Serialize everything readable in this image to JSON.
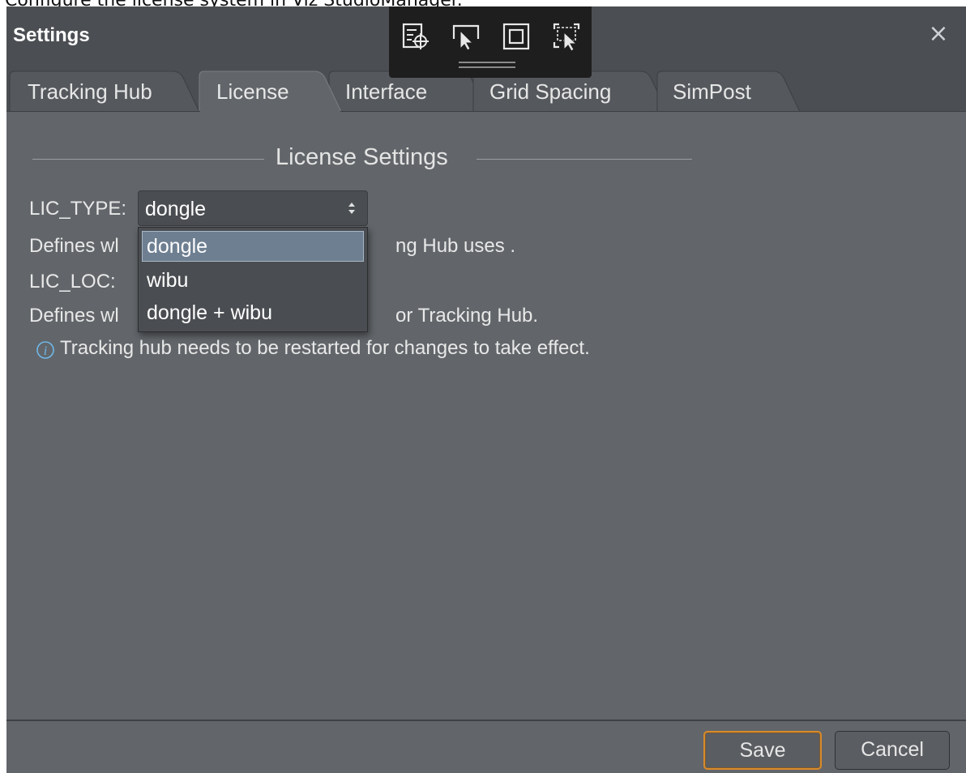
{
  "caption": "Configure the license system in Viz StudioManager.",
  "window": {
    "title": "Settings",
    "close_glyph": "×"
  },
  "capture_toolbar": {
    "icons": [
      "settings-target-icon",
      "select-pointer-icon",
      "window-capture-icon",
      "region-select-icon"
    ]
  },
  "tabs": [
    {
      "label": "Tracking Hub",
      "active": false
    },
    {
      "label": "License",
      "active": true
    },
    {
      "label": "Interface",
      "active": false
    },
    {
      "label": "Grid Spacing",
      "active": false
    },
    {
      "label": "SimPost",
      "active": false
    }
  ],
  "license": {
    "section_title": "License Settings",
    "lic_type_label": "LIC_TYPE:",
    "lic_type_value": "dongle",
    "lic_type_desc_start": "Defines wl",
    "lic_type_desc_end": "ng Hub uses .",
    "lic_loc_label": "LIC_LOC:",
    "lic_loc_desc_start": "Defines wl",
    "lic_loc_desc_end": "or Tracking Hub.",
    "dropdown_options": [
      {
        "label": "dongle",
        "selected": true
      },
      {
        "label": "wibu",
        "selected": false
      },
      {
        "label": "dongle + wibu",
        "selected": false
      }
    ],
    "info_text": "Tracking hub needs to be restarted for changes to take effect."
  },
  "footer": {
    "save_label": "Save",
    "cancel_label": "Cancel"
  },
  "colors": {
    "dialog_bg": "#62666a",
    "titlebar_bg": "#4b4e52",
    "tab_active_bg": "#62666a",
    "tab_inactive_bg": "#55595d",
    "selection_bg": "#6e7f91",
    "save_border": "#d88a2a",
    "info_icon": "#6fb7e8"
  }
}
